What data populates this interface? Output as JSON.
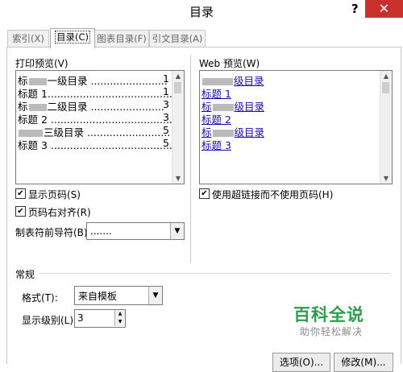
{
  "window": {
    "title": "目录",
    "help_glyph": "?",
    "close_glyph": "✕"
  },
  "tabs": [
    {
      "label": "索引(X)"
    },
    {
      "label": "目录(C)"
    },
    {
      "label": "图表目录(F)"
    },
    {
      "label": "引文目录(A)"
    }
  ],
  "print_preview": {
    "label": "打印预览(V)",
    "lines": [
      {
        "prefix": "标",
        "text": "一级目录 ........................",
        "page": "1"
      },
      {
        "prefix": "",
        "text": "标题 1.........................................",
        "page": "1"
      },
      {
        "prefix": "标",
        "text": "二级目录 .......................",
        "page": "3"
      },
      {
        "prefix": "",
        "text": "标题 2 ..........................................",
        "page": "3"
      },
      {
        "prefix": "",
        "text": "三级目录 ..........................",
        "page": "5"
      },
      {
        "prefix": "",
        "text": "标题 3 .........................................",
        "page": "5"
      }
    ]
  },
  "web_preview": {
    "label": "Web 预览(W)",
    "lines": [
      {
        "prefix": "",
        "text": "级目录"
      },
      {
        "prefix": "",
        "text": "标题 1"
      },
      {
        "prefix": "标",
        "text": "级目录"
      },
      {
        "prefix": "",
        "text": "标题 2"
      },
      {
        "prefix": "标",
        "text": "级目录"
      },
      {
        "prefix": "",
        "text": "标题 3"
      }
    ]
  },
  "options": {
    "show_page_numbers": "显示页码(S)",
    "right_align": "页码右对齐(R)",
    "tab_leader_label": "制表符前导符(B):",
    "tab_leader_value": ".......",
    "use_hyperlinks": "使用超链接而不使用页码(H)"
  },
  "general": {
    "section_label": "常规",
    "format_label": "格式(T):",
    "format_value": "来自模板",
    "levels_label": "显示级别(L):",
    "levels_value": "3"
  },
  "buttons": {
    "options": "选项(O)...",
    "modify": "修改(M)..."
  },
  "watermark": {
    "title": "百科全说",
    "subtitle": "助你轻松解决"
  }
}
